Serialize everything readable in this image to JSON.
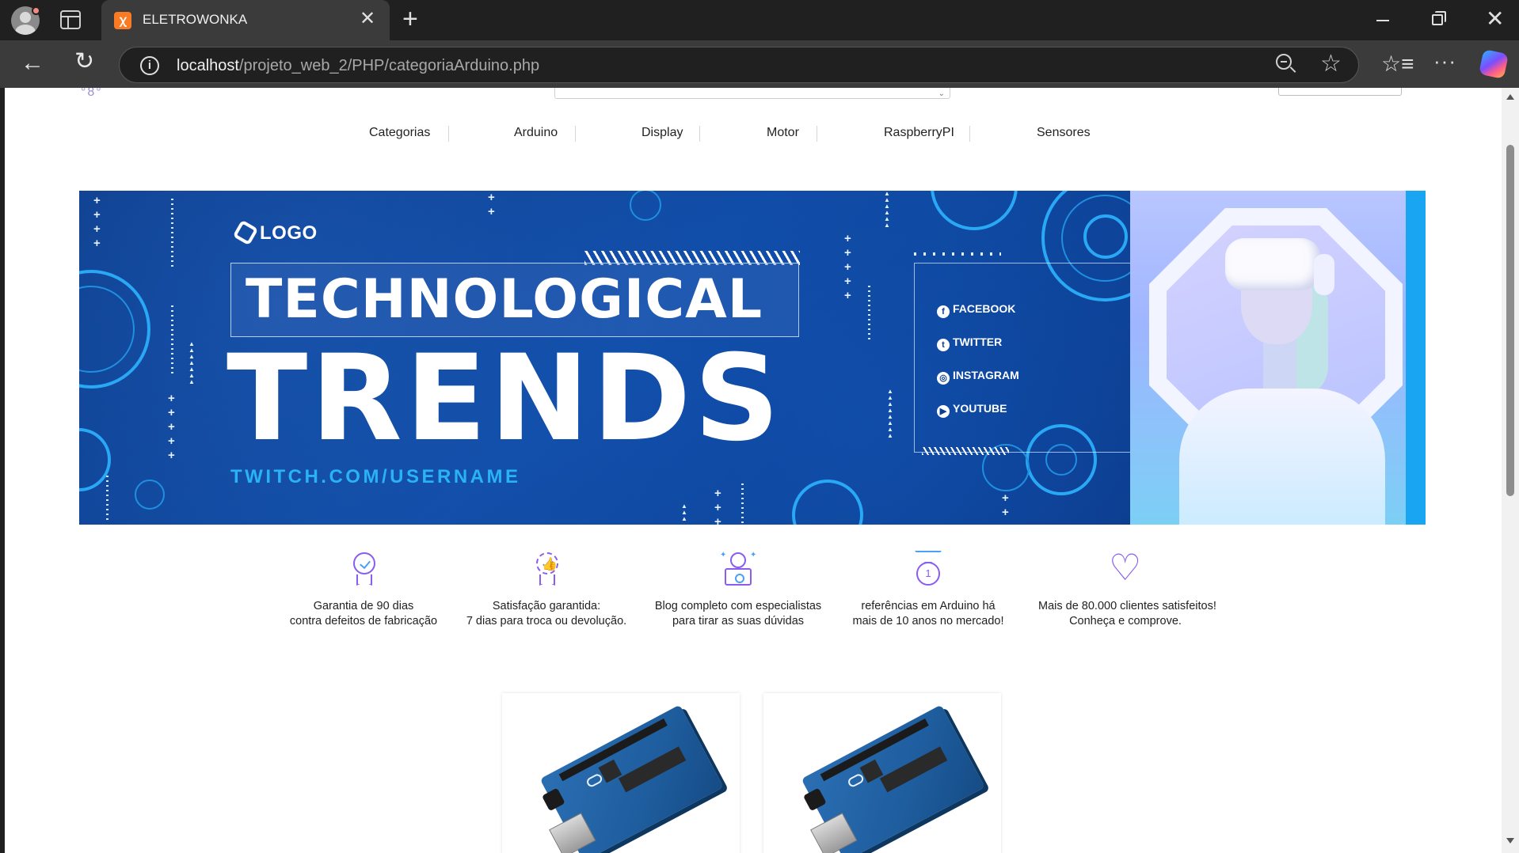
{
  "browser": {
    "tab_title": "ELETROWONKA",
    "tab_close": "✕",
    "new_tab": "+",
    "url_host": "localhost",
    "url_path": "/projeto_web_2/PHP/categoriaArduino.php",
    "window_close": "✕"
  },
  "nav": {
    "items": [
      "Categorias",
      "Arduino",
      "Display",
      "Motor",
      "RaspberryPI",
      "Sensores"
    ]
  },
  "banner": {
    "logo_text": "LOGO",
    "headline_top": "TECHNOLOGICAL",
    "headline_main": "TRENDS",
    "handle": "TWITCH.COM/USERNAME",
    "social": [
      {
        "icon": "facebook-icon",
        "glyph": "f",
        "label": "FACEBOOK"
      },
      {
        "icon": "twitter-icon",
        "glyph": "t",
        "label": "TWITTER"
      },
      {
        "icon": "instagram-icon",
        "glyph": "◎",
        "label": "INSTAGRAM"
      },
      {
        "icon": "youtube-icon",
        "glyph": "▶",
        "label": "YOUTUBE"
      }
    ],
    "colors": {
      "background": "#0d3f8f",
      "accent": "#2ab2f7"
    }
  },
  "features": [
    {
      "icon": "warranty-badge-icon",
      "line1": "Garantia de 90 dias",
      "line2": "contra defeitos de fabricação"
    },
    {
      "icon": "satisfaction-thumb-icon",
      "line1": "Satisfação garantida:",
      "line2": "7 dias para troca ou devolução."
    },
    {
      "icon": "support-laptop-icon",
      "line1": "Blog completo com especialistas",
      "line2": "para tirar as suas dúvidas"
    },
    {
      "icon": "medal-icon",
      "medal_text": "1",
      "line1": "referências em Arduino há",
      "line2": "mais de 10 anos no mercado!"
    },
    {
      "icon": "heart-icon",
      "line1": "Mais de 80.000 clientes satisfeitos!",
      "line2": "Conheça e comprove."
    }
  ],
  "products": [
    {
      "image": "arduino-uno-board"
    },
    {
      "image": "arduino-uno-board"
    }
  ],
  "theme": {
    "icon_purple": "#8a5cf0",
    "icon_blue": "#4aa0f5"
  }
}
